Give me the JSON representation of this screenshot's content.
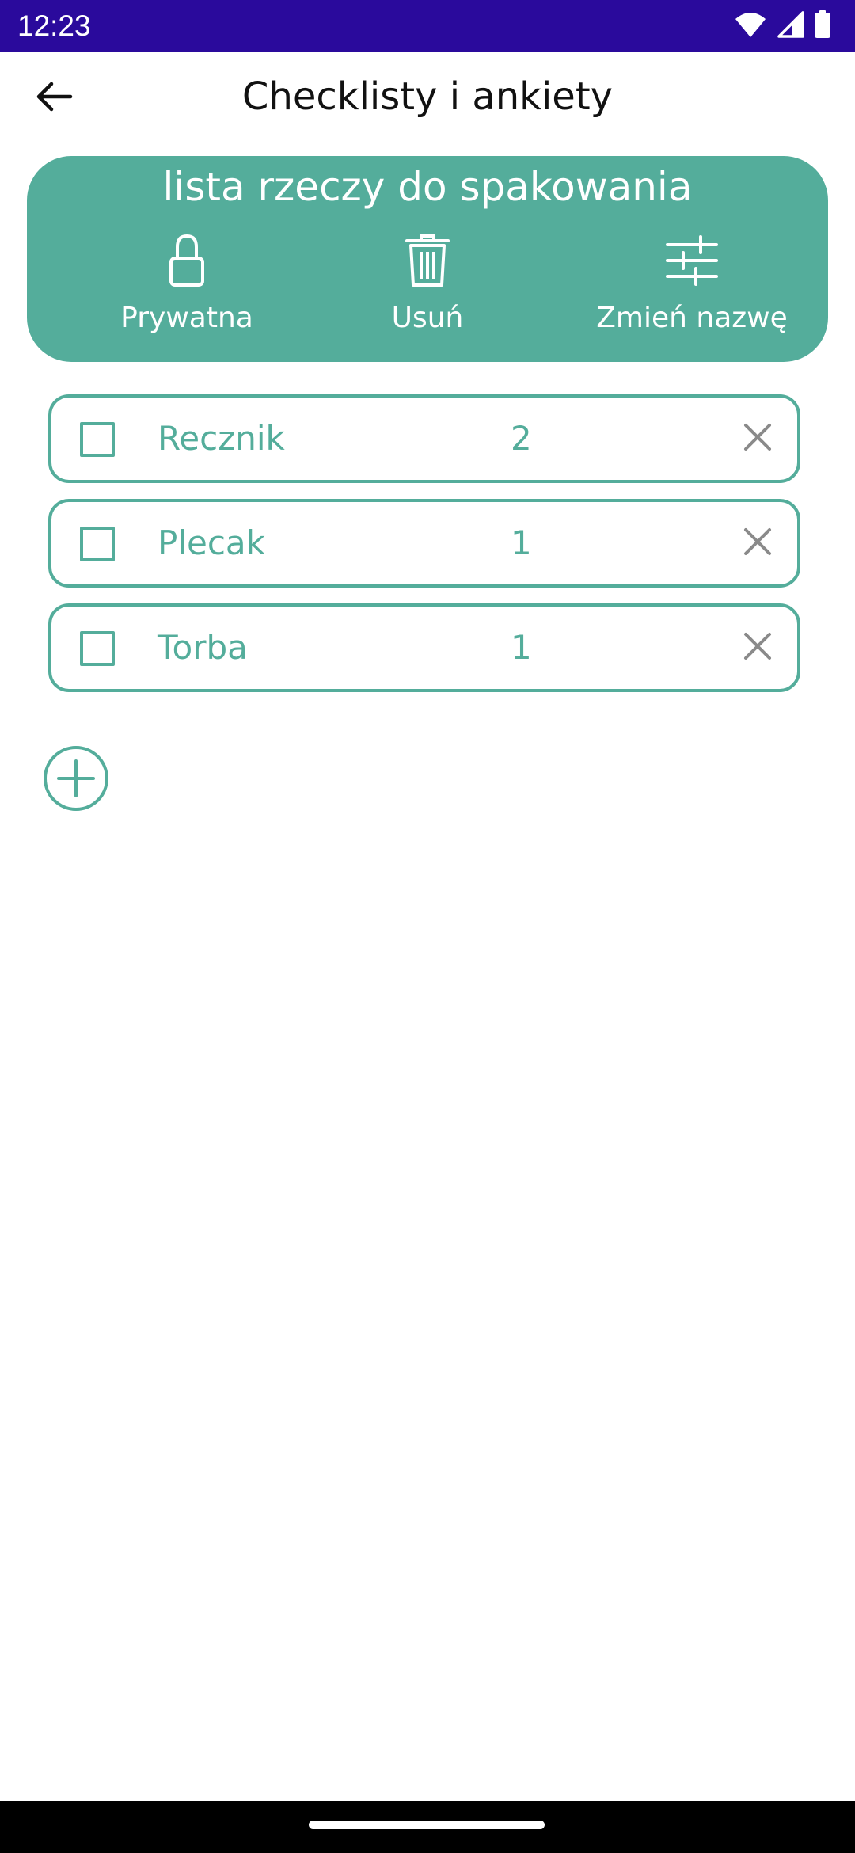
{
  "status_bar": {
    "time": "12:23",
    "icons": [
      "wifi-icon",
      "signal-icon",
      "battery-icon"
    ],
    "background": "#2a0a9c"
  },
  "app_bar": {
    "title": "Checklisty i ankiety",
    "back_icon": "arrow-left-icon"
  },
  "checklist": {
    "name": "lista rzeczy do spakowania",
    "card_color": "#54ad9b",
    "actions": [
      {
        "label": "Prywatna",
        "icon": "lock-icon"
      },
      {
        "label": "Usuń",
        "icon": "trash-icon"
      },
      {
        "label": "Zmień nazwę",
        "icon": "sliders-icon"
      }
    ]
  },
  "items": [
    {
      "name": "Recznik",
      "quantity": "2",
      "checked": false
    },
    {
      "name": "Plecak",
      "quantity": "1",
      "checked": false
    },
    {
      "name": "Torba",
      "quantity": "1",
      "checked": false
    }
  ],
  "add_button": {
    "icon": "plus-circle-icon"
  }
}
